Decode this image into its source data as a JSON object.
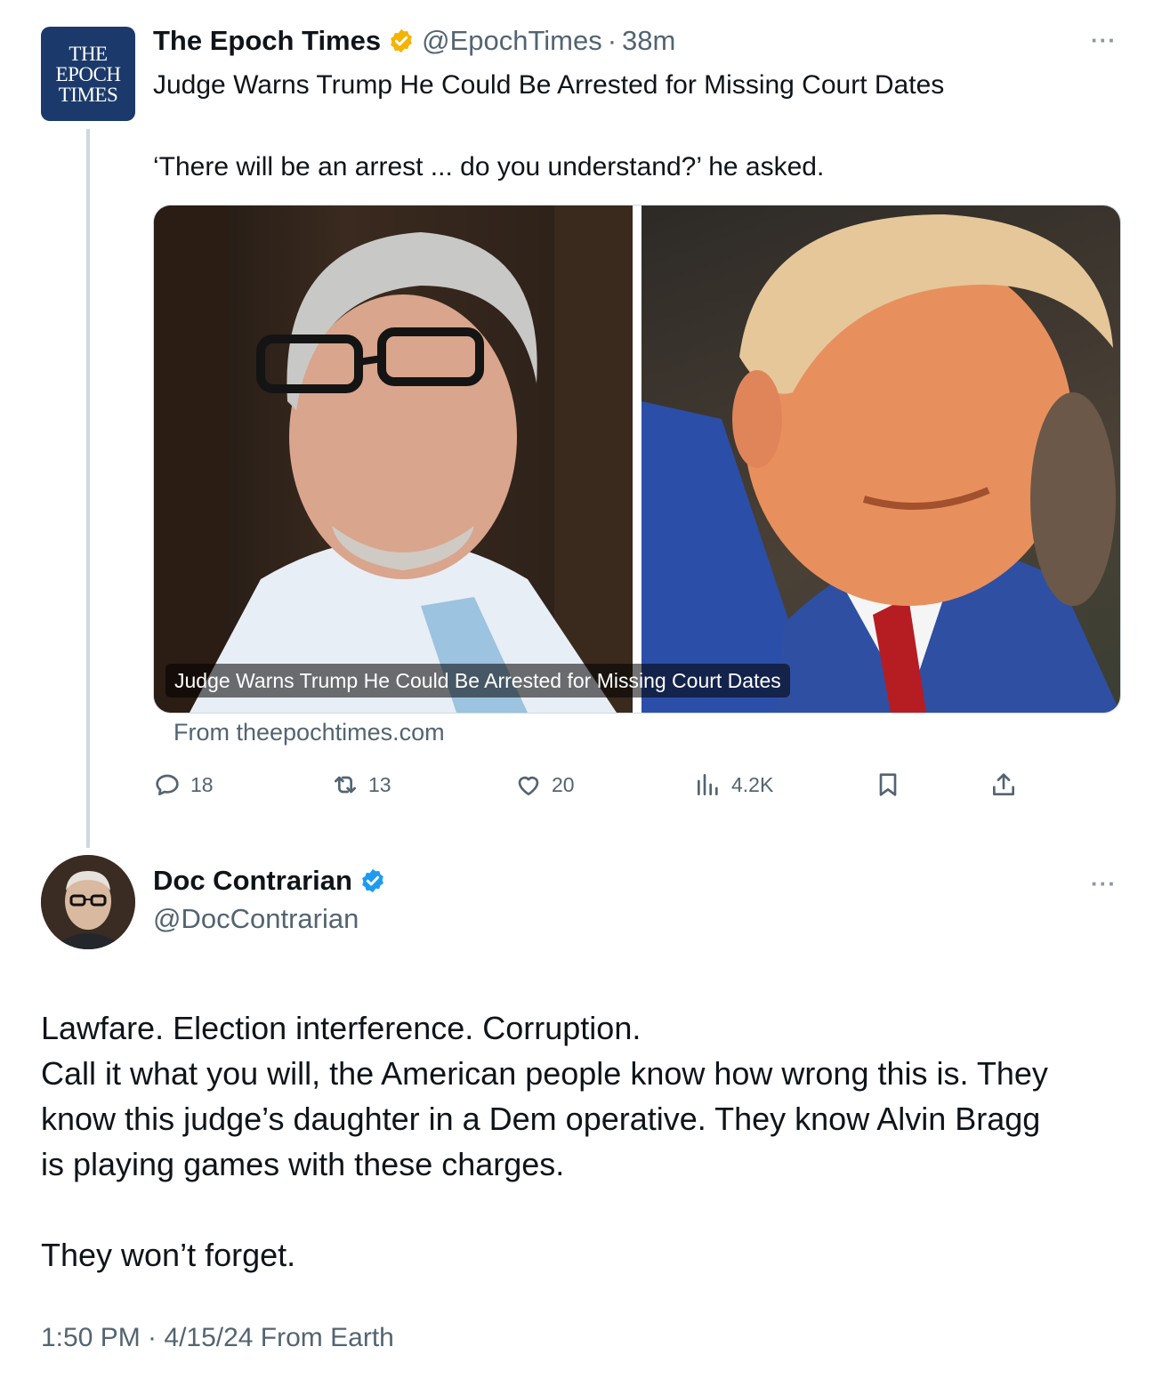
{
  "colors": {
    "verified_gold": "#f4b400",
    "verified_blue": "#1d9bf0",
    "secondary_text": "#536471",
    "epoch_brand": "#1b3a6b"
  },
  "tweet1": {
    "avatar_lines": [
      "THE",
      "EPOCH",
      "TIMES"
    ],
    "name": "The Epoch Times",
    "handle": "@EpochTimes",
    "separator": "·",
    "time": "38m",
    "headline": "Judge Warns Trump He Could Be Arrested for Missing Court Dates",
    "quote": "‘There will be an arrest ... do you understand?’ he asked.",
    "card_caption": "Judge Warns Trump He Could Be Arrested for Missing Court Dates",
    "from": "From theepochtimes.com",
    "more": "···",
    "actions": {
      "replies": "18",
      "retweets": "13",
      "likes": "20",
      "views": "4.2K"
    }
  },
  "tweet2": {
    "name": "Doc Contrarian",
    "handle": "@DocContrarian",
    "more": "···",
    "body": [
      "Lawfare. Election interference. Corruption.",
      "Call it what you will, the American people know how wrong this is. They",
      "know this judge’s daughter in a Dem operative. They know Alvin Bragg",
      "is playing games with these charges.",
      "",
      "They won’t forget."
    ],
    "meta": "1:50 PM · 4/15/24 From Earth"
  }
}
